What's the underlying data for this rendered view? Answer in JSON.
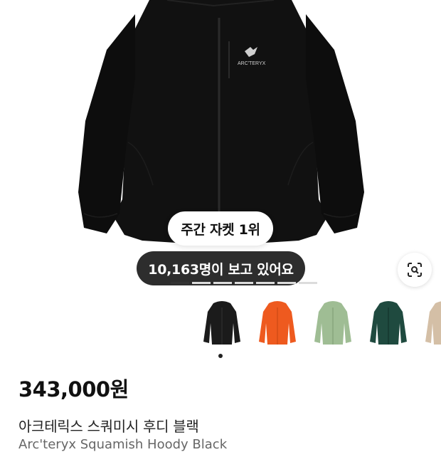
{
  "hero": {
    "brand_logo_text": "ARC'TERYX",
    "rank_badge": "주간 자켓 1위",
    "viewer_count": "10,163명이 보고 있어요",
    "progress_segments": 7,
    "progress_active_index": 0
  },
  "thumbnails": [
    {
      "color_name": "black",
      "color": "#1b1b1b"
    },
    {
      "color_name": "orange",
      "color": "#ee5a1f"
    },
    {
      "color_name": "sage green",
      "color": "#9fbd94"
    },
    {
      "color_name": "dark green",
      "color": "#1f4a3f"
    },
    {
      "color_name": "beige",
      "color": "#d4bfa6"
    }
  ],
  "product": {
    "price": "343,000원",
    "title": "아크테릭스 스쿼미시 후디 블랙",
    "subtitle": "Arc'teryx Squamish Hoody Black"
  },
  "icons": {
    "visual_search": "lens-search-icon"
  }
}
